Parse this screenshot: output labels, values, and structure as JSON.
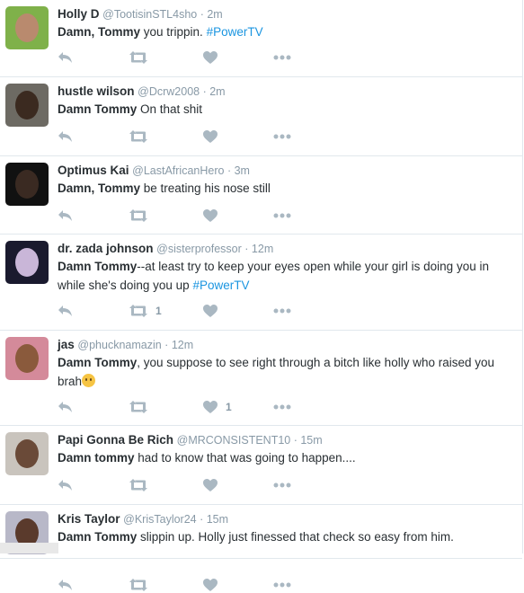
{
  "tweets": [
    {
      "name": "Holly D",
      "handle": "@TootisinSTL4sho",
      "time": "2m",
      "parts": [
        {
          "t": "Damn, Tommy",
          "s": "bold"
        },
        {
          "t": " you trippin. ",
          "s": "plain"
        },
        {
          "t": "#PowerTV",
          "s": "hashtag"
        }
      ],
      "retweets": "",
      "likes": "",
      "avatar": {
        "bg": "#7fb14a",
        "face": "#b98a6e"
      }
    },
    {
      "name": "hustle wilson",
      "handle": "@Dcrw2008",
      "time": "2m",
      "parts": [
        {
          "t": "Damn Tommy",
          "s": "bold"
        },
        {
          "t": " On that shit",
          "s": "plain"
        }
      ],
      "retweets": "",
      "likes": "",
      "avatar": {
        "bg": "#6d6a63",
        "face": "#3b2a20"
      }
    },
    {
      "name": "Optimus Kai",
      "handle": "@LastAfricanHero",
      "time": "3m",
      "parts": [
        {
          "t": "Damn, Tommy",
          "s": "bold"
        },
        {
          "t": " be treating his nose still",
          "s": "plain"
        }
      ],
      "retweets": "",
      "likes": "",
      "avatar": {
        "bg": "#111111",
        "face": "#3a2a22"
      }
    },
    {
      "name": "dr. zada johnson",
      "handle": "@sisterprofessor",
      "time": "12m",
      "parts": [
        {
          "t": "Damn Tommy",
          "s": "bold"
        },
        {
          "t": "--at least try to keep your eyes open while your girl is doing you in while she's doing you up ",
          "s": "plain"
        },
        {
          "t": "#PowerTV",
          "s": "hashtag"
        }
      ],
      "retweets": "1",
      "likes": "",
      "avatar": {
        "bg": "#1a1a2e",
        "face": "#c9b6d8"
      }
    },
    {
      "name": "jas",
      "handle": "@phucknamazin",
      "time": "12m",
      "parts": [
        {
          "t": "Damn Tommy",
          "s": "bold"
        },
        {
          "t": ", you suppose to see right through a bitch like holly who raised you brah",
          "s": "plain"
        },
        {
          "t": "",
          "s": "emoji"
        }
      ],
      "retweets": "",
      "likes": "1",
      "avatar": {
        "bg": "#d48a9a",
        "face": "#8a5a3c"
      }
    },
    {
      "name": "Papi Gonna Be Rich",
      "handle": "@MRCONSISTENT10",
      "time": "15m",
      "parts": [
        {
          "t": "Damn tommy",
          "s": "bold"
        },
        {
          "t": " had to know that was going to happen....",
          "s": "plain"
        }
      ],
      "retweets": "",
      "likes": "",
      "avatar": {
        "bg": "#c9c4bd",
        "face": "#6a4a38"
      }
    },
    {
      "name": "Kris Taylor",
      "handle": "@KrisTaylor24",
      "time": "15m",
      "parts": [
        {
          "t": "Damn Tommy",
          "s": "bold"
        },
        {
          "t": " slippin up. Holly just finessed that check so easy from him.",
          "s": "plain"
        }
      ],
      "retweets": "",
      "likes": "",
      "avatar": {
        "bg": "#b8b8c8",
        "face": "#5a3a2c"
      }
    }
  ],
  "icons": {
    "reply": "reply-icon",
    "retweet": "retweet-icon",
    "like": "heart-icon",
    "more": "more-icon"
  },
  "colors": {
    "icon": "#aab8c2",
    "hashtag": "#1b95e0",
    "meta": "#8899a6",
    "text": "#292f33"
  }
}
